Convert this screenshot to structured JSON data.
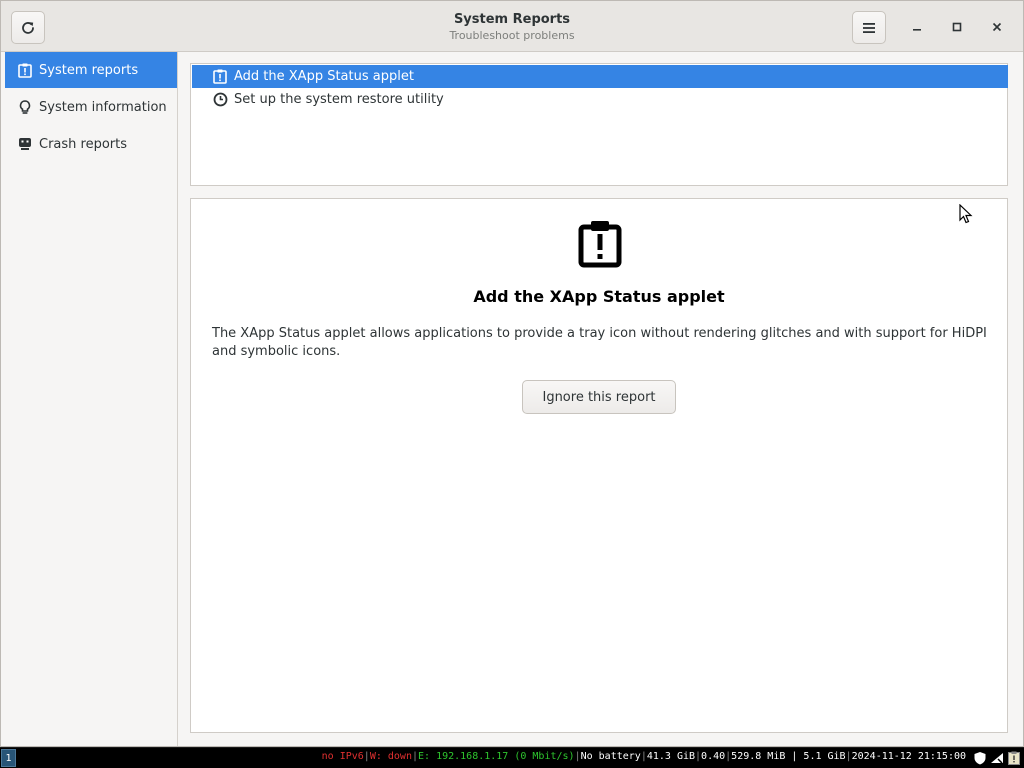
{
  "window": {
    "title": "System Reports",
    "subtitle": "Troubleshoot problems"
  },
  "header": {
    "refresh_icon": "refresh-icon",
    "menu_icon": "hamburger-menu-icon",
    "minimize_glyph": "–",
    "maximize_glyph": "□",
    "close_glyph": "✕"
  },
  "sidebar": {
    "items": [
      {
        "label": "System reports",
        "icon": "clipboard-alert-icon",
        "active": true
      },
      {
        "label": "System information",
        "icon": "lightbulb-icon",
        "active": false
      },
      {
        "label": "Crash reports",
        "icon": "crash-face-icon",
        "active": false
      }
    ]
  },
  "reports": {
    "items": [
      {
        "label": "Add the XApp Status applet",
        "icon": "clipboard-alert-icon",
        "selected": true
      },
      {
        "label": "Set up the system restore utility",
        "icon": "clock-icon",
        "selected": false
      }
    ]
  },
  "detail": {
    "icon": "clipboard-alert-icon",
    "title": "Add the XApp Status applet",
    "description": "The XApp Status applet allows applications to provide a tray icon without rendering glitches and with support for HiDPI and symbolic icons.",
    "ignore_button": "Ignore this report"
  },
  "statusbar": {
    "workspace": "1",
    "ipv6": "no IPv6",
    "wireless": "W: down",
    "ethernet": "E: 192.168.1.17 (0 Mbit/s)",
    "battery": "No battery",
    "disk": "41.3 GiB",
    "load": "0.40",
    "memory": "529.8 MiB",
    "swap": "5.1 GiB",
    "datetime": "2024-11-12 21:15:00",
    "colors": {
      "bad": "#e03030",
      "good": "#2ec52e"
    }
  },
  "colors": {
    "accent": "#3584e4",
    "headerbar": "#e8e6e3",
    "window_bg": "#f6f5f4"
  }
}
